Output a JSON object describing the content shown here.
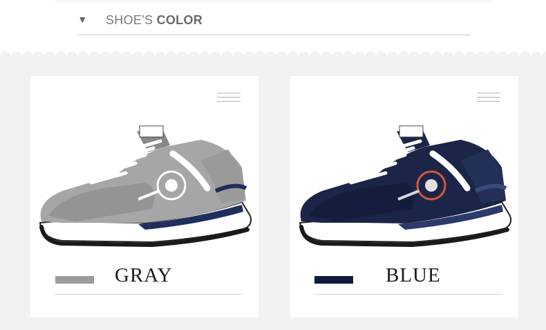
{
  "header": {
    "arrow_icon": "triangle-down-icon",
    "title_prefix": "SHOE'S",
    "title_bold": "COLOR"
  },
  "colors": {
    "band_background": "#f2f2f2",
    "gray_swatch": "#9c9c9c",
    "blue_swatch": "#101a3c"
  },
  "cards": [
    {
      "label": "GRAY",
      "swatch_color": "#9c9c9c",
      "icon": "menu-lines-icon",
      "image": "gray-sneaker"
    },
    {
      "label": "BLUE",
      "swatch_color": "#101a3c",
      "icon": "menu-lines-icon",
      "image": "navy-blue-sneaker"
    }
  ]
}
